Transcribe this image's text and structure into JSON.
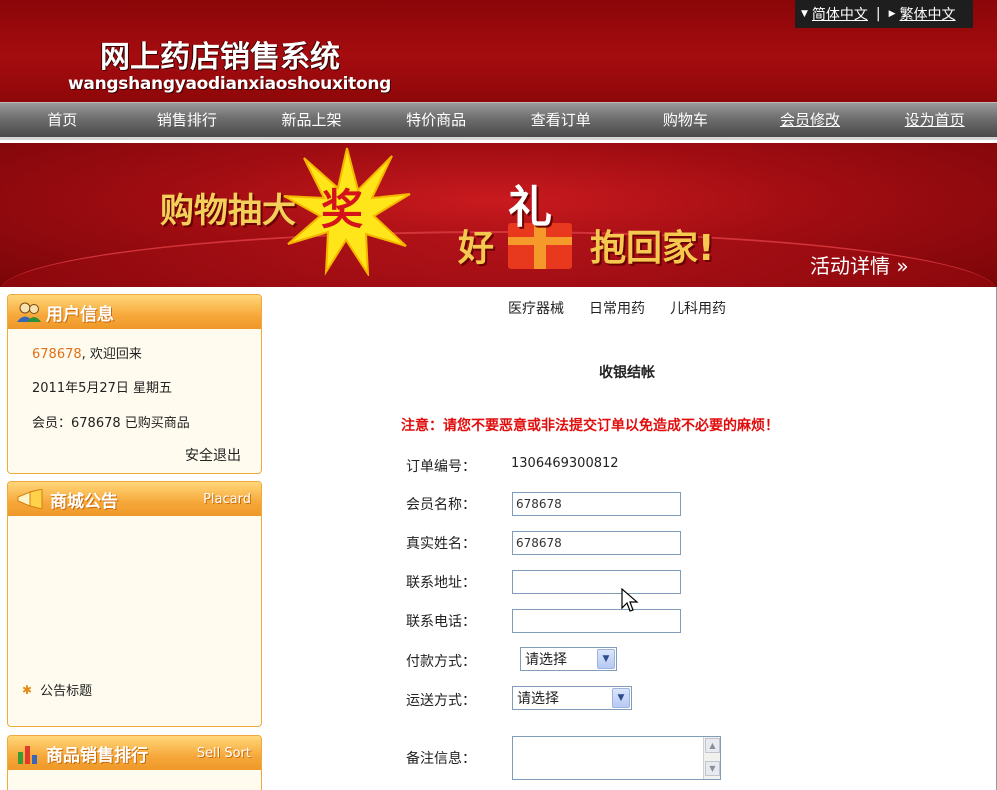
{
  "language_bar": {
    "simplified": "简体中文",
    "traditional": "繁体中文",
    "separator": "|"
  },
  "site": {
    "title": "网上药店销售系统",
    "pinyin": "wangshangyaodianxiaoshouxitong"
  },
  "nav": {
    "items": [
      {
        "label": "首页"
      },
      {
        "label": "销售排行"
      },
      {
        "label": "新品上架"
      },
      {
        "label": "特价商品"
      },
      {
        "label": "查看订单"
      },
      {
        "label": "购物车"
      },
      {
        "label": "会员修改"
      },
      {
        "label": "设为首页"
      }
    ]
  },
  "banner": {
    "text1": "购物抽大",
    "star_char": "奖",
    "text2a": "好",
    "gift_char": "礼",
    "text2b": "抱回家!",
    "detail": "活动详情 »"
  },
  "user_info": {
    "title": "用户信息",
    "username": "678678",
    "welcome": ", 欢迎回来",
    "date": "2011年5月27日  星期五",
    "member_line": "会员：678678  已购买商品",
    "logout": "安全退出"
  },
  "notice": {
    "title": "商城公告",
    "subtitle": "Placard",
    "item": "公告标题"
  },
  "rank": {
    "title": "商品销售排行",
    "subtitle": "Sell Sort"
  },
  "categories": [
    "医疗器械",
    "日常用药",
    "儿科用药"
  ],
  "checkout": {
    "title": "收银结帐",
    "warning": "注意：请您不要恶意或非法提交订单以免造成不必要的麻烦！",
    "order_no_label": "订单编号：",
    "order_no": "1306469300812",
    "member_name_label": "会员名称：",
    "member_name": "678678",
    "real_name_label": "真实姓名：",
    "real_name": "678678",
    "address_label": "联系地址：",
    "address": "",
    "phone_label": "联系电话：",
    "phone": "",
    "payment_label": "付款方式：",
    "payment": "请选择",
    "shipping_label": "运送方式：",
    "shipping": "请选择",
    "remark_label": "备注信息："
  },
  "colors": {
    "header_red": "#a50c0f",
    "warning_red": "#e10d0d",
    "sidebar_orange": "#f6a83a",
    "username_orange": "#e0701a"
  }
}
